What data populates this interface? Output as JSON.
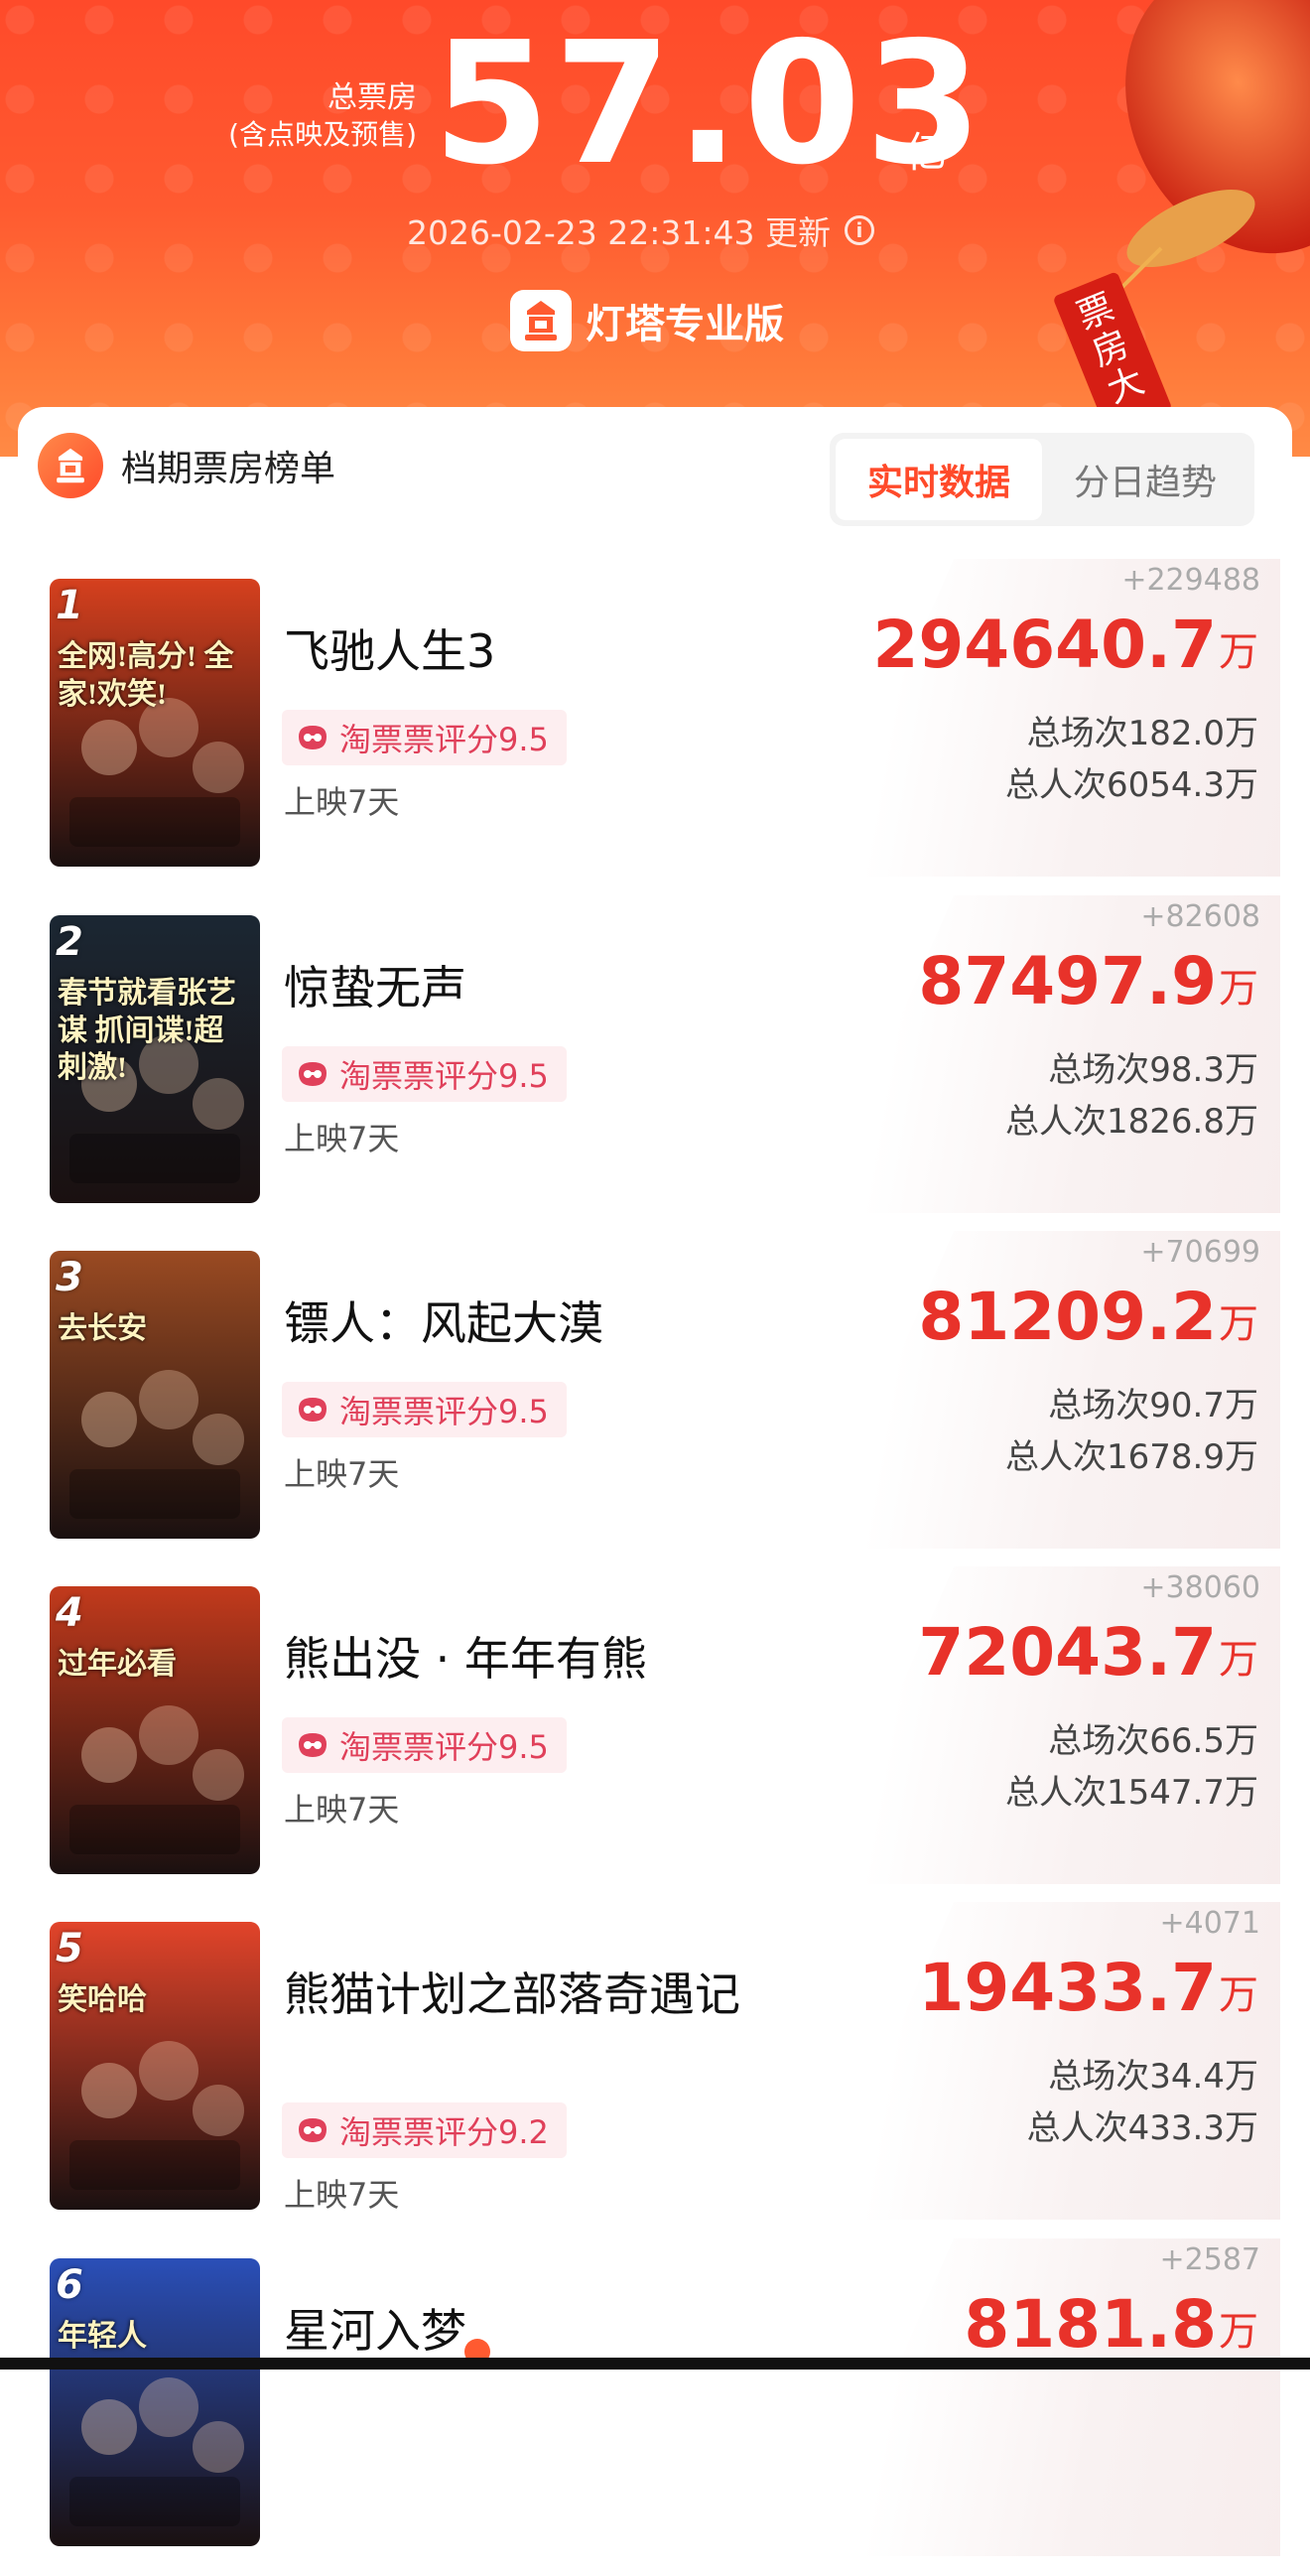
{
  "header": {
    "total_label_line1": "总票房",
    "total_label_line2": "(含点映及预售)",
    "total_value": "57.03",
    "total_unit": "亿",
    "update_time": "2026-02-23 22:31:43 更新",
    "brand_name": "灯塔专业版",
    "lantern_text": "票房大卖",
    "info_icon": "info-icon"
  },
  "ranking": {
    "title": "档期票房榜单",
    "tabs": [
      {
        "label": "实时数据",
        "active": true
      },
      {
        "label": "分日趋势",
        "active": false
      }
    ]
  },
  "movies": [
    {
      "rank": "1",
      "title": "飞驰人生3",
      "rating": "淘票票评分9.5",
      "days": "上映7天",
      "delta": "+229488",
      "box_office": "294640.7",
      "box_unit": "万",
      "screenings": "总场次182.0万",
      "admissions": "总人次6054.3万",
      "poster_text": "全网!高分! 全家!欢笑!",
      "poster_color": "#d6401e"
    },
    {
      "rank": "2",
      "title": "惊蛰无声",
      "rating": "淘票票评分9.5",
      "days": "上映7天",
      "delta": "+82608",
      "box_office": "87497.9",
      "box_unit": "万",
      "screenings": "总场次98.3万",
      "admissions": "总人次1826.8万",
      "poster_text": "春节就看张艺谋 抓间谍!超刺激!",
      "poster_color": "#1b2733"
    },
    {
      "rank": "3",
      "title": "镖人：风起大漠",
      "rating": "淘票票评分9.5",
      "days": "上映7天",
      "delta": "+70699",
      "box_office": "81209.2",
      "box_unit": "万",
      "screenings": "总场次90.7万",
      "admissions": "总人次1678.9万",
      "poster_text": "去长安",
      "poster_color": "#9a4a22"
    },
    {
      "rank": "4",
      "title": "熊出没 · 年年有熊",
      "rating": "淘票票评分9.5",
      "days": "上映7天",
      "delta": "+38060",
      "box_office": "72043.7",
      "box_unit": "万",
      "screenings": "总场次66.5万",
      "admissions": "总人次1547.7万",
      "poster_text": "过年必看",
      "poster_color": "#c23a1c"
    },
    {
      "rank": "5",
      "title": "熊猫计划之部落奇遇记",
      "rating": "淘票票评分9.2",
      "days": "上映7天",
      "delta": "+4071",
      "box_office": "19433.7",
      "box_unit": "万",
      "screenings": "总场次34.4万",
      "admissions": "总人次433.3万",
      "poster_text": "笑哈哈",
      "poster_color": "#e2442a"
    },
    {
      "rank": "6",
      "title": "星河入梦",
      "rating": "",
      "days": "",
      "delta": "+2587",
      "box_office": "8181.8",
      "box_unit": "万",
      "screenings": "",
      "admissions": "",
      "poster_text": "年轻人",
      "poster_color": "#2a4fb8"
    }
  ],
  "colors": {
    "header_bg": "#ff5a30",
    "accent": "#ff4a2a",
    "box_office_red": "#e8322a",
    "rating_pink": "#e0405a"
  }
}
